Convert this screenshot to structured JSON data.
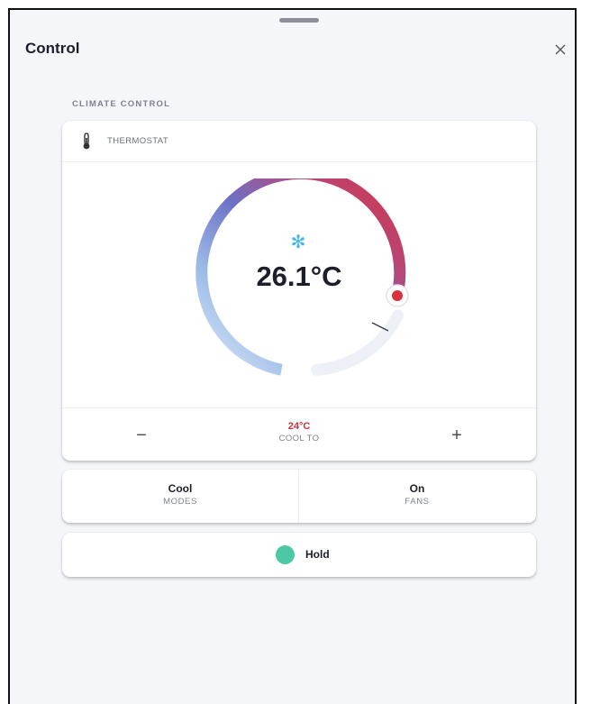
{
  "header": {
    "title": "Control",
    "close_icon": "close-icon"
  },
  "section": {
    "label": "CLIMATE CONTROL"
  },
  "thermostat": {
    "header_label": "THERMOSTAT",
    "header_icon": "thermometer-icon",
    "mode_icon": "snowflake-icon",
    "current_temp": "26.1°C",
    "setpoint_value": "24°C",
    "setpoint_label": "COOL TO",
    "minus_label": "−",
    "plus_label": "+",
    "colors": {
      "cool": "#c7def5",
      "mid": "#6f78c9",
      "hot": "#d43a47",
      "track": "#eef0f8",
      "setpoint_text": "#c7343f"
    }
  },
  "modes": {
    "value": "Cool",
    "label": "MODES"
  },
  "fans": {
    "value": "On",
    "label": "FANS"
  },
  "hold": {
    "label": "Hold",
    "indicator_color": "#4cc8a4"
  }
}
